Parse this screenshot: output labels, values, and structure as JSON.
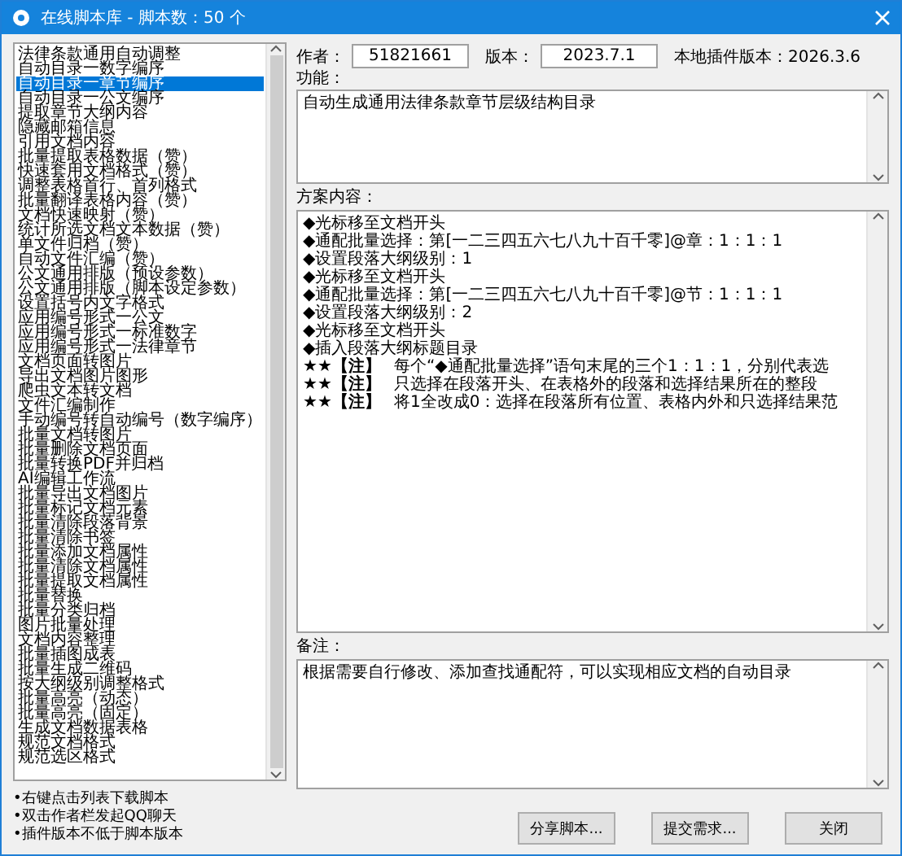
{
  "window": {
    "title": "在线脚本库 - 脚本数：50 个"
  },
  "scripts": [
    {
      "label": "法律条款通用自动调整",
      "selected": false
    },
    {
      "label": "自动目录一数字编序",
      "selected": false
    },
    {
      "label": "自动目录一章节编序",
      "selected": true
    },
    {
      "label": "自动目录一公文编序",
      "selected": false
    },
    {
      "label": "提取章节大纲内容",
      "selected": false
    },
    {
      "label": "隐藏邮箱信息",
      "selected": false
    },
    {
      "label": "引用文档内容",
      "selected": false
    },
    {
      "label": "批量提取表格数据（赞）",
      "selected": false
    },
    {
      "label": "快速套用文档格式（赞）",
      "selected": false
    },
    {
      "label": "调整表格首行、首列格式",
      "selected": false
    },
    {
      "label": "批量翻译表格内容（赞）",
      "selected": false
    },
    {
      "label": "文档快速映射（赞）",
      "selected": false
    },
    {
      "label": "统计所选文档文本数据（赞）",
      "selected": false
    },
    {
      "label": "单文件归档（赞）",
      "selected": false
    },
    {
      "label": "自动文件汇编（赞）",
      "selected": false
    },
    {
      "label": "公文通用排版（预设参数）",
      "selected": false
    },
    {
      "label": "公文通用排版（脚本设定参数）",
      "selected": false
    },
    {
      "label": "设置括号内文字格式",
      "selected": false
    },
    {
      "label": "应用编号形式一公文",
      "selected": false
    },
    {
      "label": "应用编号形式一标准数字",
      "selected": false
    },
    {
      "label": "应用编号形式一法律章节",
      "selected": false
    },
    {
      "label": "文档页面转图片",
      "selected": false
    },
    {
      "label": "导出文档图片图形",
      "selected": false
    },
    {
      "label": "爬虫文本转文档",
      "selected": false
    },
    {
      "label": "文件汇编制作",
      "selected": false
    },
    {
      "label": "手动编号转自动编号（数字编序）",
      "selected": false
    },
    {
      "label": "批量文档转图片",
      "selected": false
    },
    {
      "label": "批量删除文档页面",
      "selected": false
    },
    {
      "label": "批量转换PDF并归档",
      "selected": false
    },
    {
      "label": "AI编辑工作流",
      "selected": false
    },
    {
      "label": "批量导出文档图片",
      "selected": false
    },
    {
      "label": "批量标记文档元素",
      "selected": false
    },
    {
      "label": "批量清除段落背景",
      "selected": false
    },
    {
      "label": "批量清除书签",
      "selected": false
    },
    {
      "label": "批量添加文档属性",
      "selected": false
    },
    {
      "label": "批量清除文档属性",
      "selected": false
    },
    {
      "label": "批量提取文档属性",
      "selected": false
    },
    {
      "label": "批量替换",
      "selected": false
    },
    {
      "label": "批量分类归档",
      "selected": false
    },
    {
      "label": "图片批量处理",
      "selected": false
    },
    {
      "label": "文档内容整理",
      "selected": false
    },
    {
      "label": "批量插图成表",
      "selected": false
    },
    {
      "label": "批量生成二维码",
      "selected": false
    },
    {
      "label": "按大纲级别调整格式",
      "selected": false
    },
    {
      "label": "批量高亮（动态）",
      "selected": false
    },
    {
      "label": "批量高亮（固定）",
      "selected": false
    },
    {
      "label": "生成文档数据表格",
      "selected": false
    },
    {
      "label": "规范文档格式",
      "selected": false
    },
    {
      "label": "规范选区格式",
      "selected": false
    }
  ],
  "hints": [
    "•右键点击列表下载脚本",
    "•双击作者栏发起QQ聊天",
    "•插件版本不低于脚本版本"
  ],
  "author": {
    "label": "作者：",
    "value": "51821661"
  },
  "version": {
    "label": "版本：",
    "value": "2023.7.1"
  },
  "local_version": "本地插件版本：2026.3.6",
  "function": {
    "label": "功能：",
    "value": "自动生成通用法律条款章节层级结构目录"
  },
  "content": {
    "label": "方案内容：",
    "lines": [
      {
        "kind": "step",
        "text": "◆光标移至文档开头"
      },
      {
        "kind": "step",
        "text": "◆通配批量选择：第[一二三四五六七八九十百千零]@章：1：1：1"
      },
      {
        "kind": "step",
        "text": "◆设置段落大纲级别：1"
      },
      {
        "kind": "step",
        "text": "◆光标移至文档开头"
      },
      {
        "kind": "step",
        "text": "◆通配批量选择：第[一二三四五六七八九十百千零]@节：1：1：1"
      },
      {
        "kind": "step",
        "text": "◆设置段落大纲级别：2"
      },
      {
        "kind": "step",
        "text": "◆光标移至文档开头"
      },
      {
        "kind": "step",
        "text": "◆插入段落大纲标题目录"
      },
      {
        "kind": "note",
        "marker": "★★【注】",
        "text": "每个“◆通配批量选择”语句末尾的三个1：1：1，分别代表选"
      },
      {
        "kind": "note",
        "marker": "★★【注】",
        "text": "只选择在段落开头、在表格外的段落和选择结果所在的整段"
      },
      {
        "kind": "note",
        "marker": "★★【注】",
        "text": "将1全改成0：选择在段落所有位置、表格内外和只选择结果范"
      }
    ]
  },
  "notes": {
    "label": "备注：",
    "value": "根据需要自行修改、添加查找通配符，可以实现相应文档的自动目录"
  },
  "buttons": [
    "分享脚本...",
    "提交需求...",
    "关闭"
  ]
}
